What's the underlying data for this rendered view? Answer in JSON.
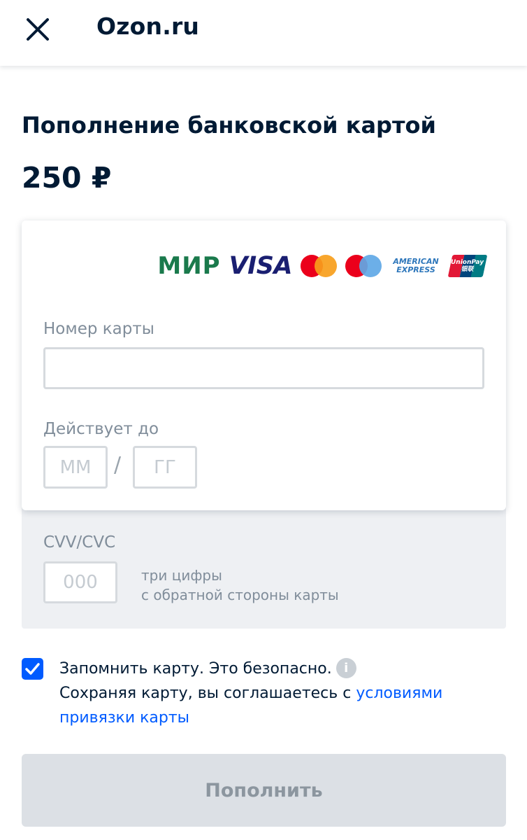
{
  "header": {
    "title": "Ozon.ru",
    "close_icon": "close-icon"
  },
  "page": {
    "title": "Пополнение банковской картой",
    "amount": "250 ₽"
  },
  "card_logos": {
    "mir": "МИР",
    "visa": "VISA",
    "amex_line1": "AMERICAN",
    "amex_line2": "EXPRESS",
    "unionpay_line1": "UnionPay",
    "unionpay_line2": "银联"
  },
  "card_form": {
    "card_number_label": "Номер карты",
    "card_number_value": "",
    "expiry_label": "Действует до",
    "month_placeholder": "ММ",
    "year_placeholder": "ГГ",
    "separator": "/"
  },
  "back_form": {
    "cvv_label": "CVV/CVC",
    "cvv_placeholder": "000",
    "cvv_hint_line1": "три цифры",
    "cvv_hint_line2": "с обратной стороны карты"
  },
  "remember": {
    "checked": true,
    "text": "Запомнить карту. Это безопасно.",
    "info_icon": "info-icon",
    "agreement_prefix": "Сохраняя карту, вы соглашаетесь с ",
    "terms_link": "условиями привязки карты"
  },
  "submit": {
    "label": "Пополнить"
  },
  "colors": {
    "accent": "#005bff",
    "text": "#001a34",
    "muted": "#808d9a",
    "disabled_button": "#dce0e5"
  }
}
